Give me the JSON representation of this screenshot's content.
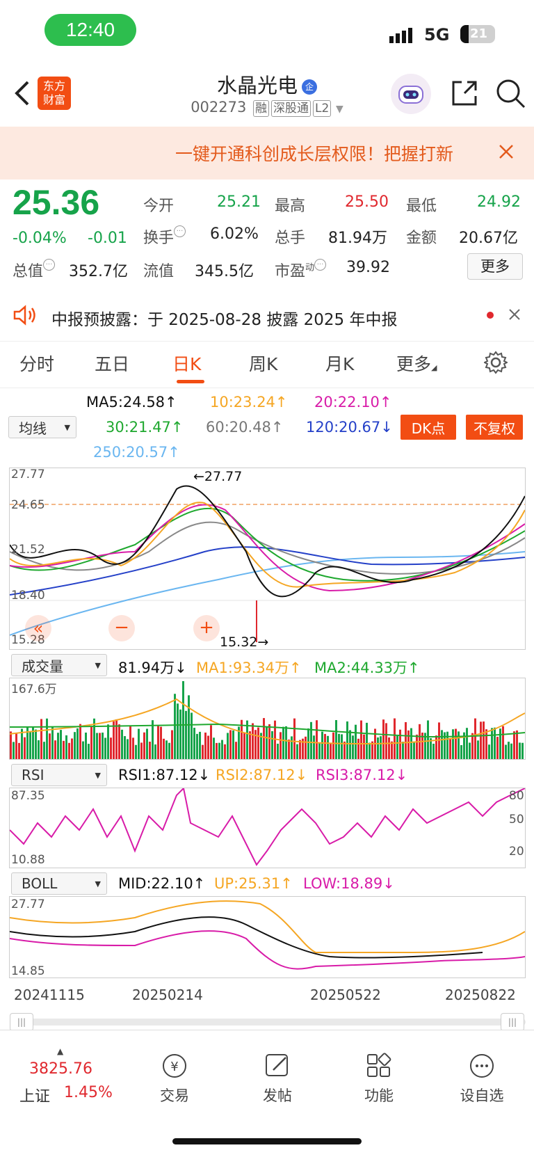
{
  "status": {
    "time": "12:40",
    "network": "5G",
    "battery": "21"
  },
  "header": {
    "brand_line1": "东方",
    "brand_line2": "财富",
    "stock_name": "水晶光电",
    "stock_code": "002273",
    "tags": [
      "融",
      "深股通",
      "L2"
    ]
  },
  "banner": {
    "text": "一键开通科创成长层权限！把握打新"
  },
  "quote": {
    "price": "25.36",
    "change_pct": "-0.04%",
    "change": "-0.01",
    "open_label": "今开",
    "open": "25.21",
    "high_label": "最高",
    "high": "25.50",
    "low_label": "最低",
    "low": "24.92",
    "turnover_label": "换手",
    "turnover": "6.02%",
    "volume_label": "总手",
    "volume": "81.94万",
    "amount_label": "金额",
    "amount": "20.67亿",
    "mktcap_label": "总值",
    "mktcap": "352.7亿",
    "float_label": "流值",
    "float": "345.5亿",
    "pe_label": "市盈",
    "pe_sup": "动",
    "pe": "39.92",
    "more": "更多"
  },
  "notice": {
    "text": "中报预披露：于 2025-08-28 披露 2025 年中报"
  },
  "tabs": [
    "分时",
    "五日",
    "日K",
    "周K",
    "月K",
    "更多"
  ],
  "active_tab": "日K",
  "ma": {
    "selector": "均线",
    "ma5": "MA5:24.58↑",
    "ma10": "10:23.24↑",
    "ma20": "20:22.10↑",
    "ma30": "30:21.47↑",
    "ma60": "60:20.48↑",
    "ma120": "120:20.67↓",
    "ma250": "250:20.57↑",
    "dk_btn": "DK点",
    "fq_btn": "不复权"
  },
  "kline": {
    "y_labels": [
      "27.77",
      "24.65",
      "21.52",
      "18.40",
      "15.28"
    ],
    "max_label": "←27.77",
    "min_label": "15.32→"
  },
  "volume": {
    "selector": "成交量",
    "current": "81.94万↓",
    "ma1": "MA1:93.34万↑",
    "ma2": "MA2:44.33万↑",
    "max_label": "167.6万"
  },
  "rsi": {
    "selector": "RSI",
    "rsi1": "RSI1:87.12↓",
    "rsi2": "RSI2:87.12↓",
    "rsi3": "RSI3:87.12↓",
    "y_top": "87.35",
    "y_bottom": "10.88",
    "levels": [
      "80",
      "50",
      "20"
    ]
  },
  "boll": {
    "selector": "BOLL",
    "mid": "MID:22.10↑",
    "up": "UP:25.31↑",
    "low": "LOW:18.89↓",
    "y_top": "27.77",
    "y_bottom": "14.85"
  },
  "dates": [
    "20241115",
    "20250214",
    "20250522",
    "20250822"
  ],
  "bottom": {
    "index_value": "3825.76",
    "index_name": "上证",
    "index_pct": "1.45%",
    "items": [
      "交易",
      "发帖",
      "功能",
      "设自选"
    ]
  },
  "colors": {
    "up": "#e0282e",
    "down": "#16a34a",
    "accent": "#f24d13",
    "ma5": "#111111",
    "ma10": "#f5a623",
    "ma20": "#d81ba8",
    "ma30": "#1fa82f",
    "ma60": "#888888",
    "ma120": "#2440c8",
    "ma250": "#6ab6f0"
  }
}
